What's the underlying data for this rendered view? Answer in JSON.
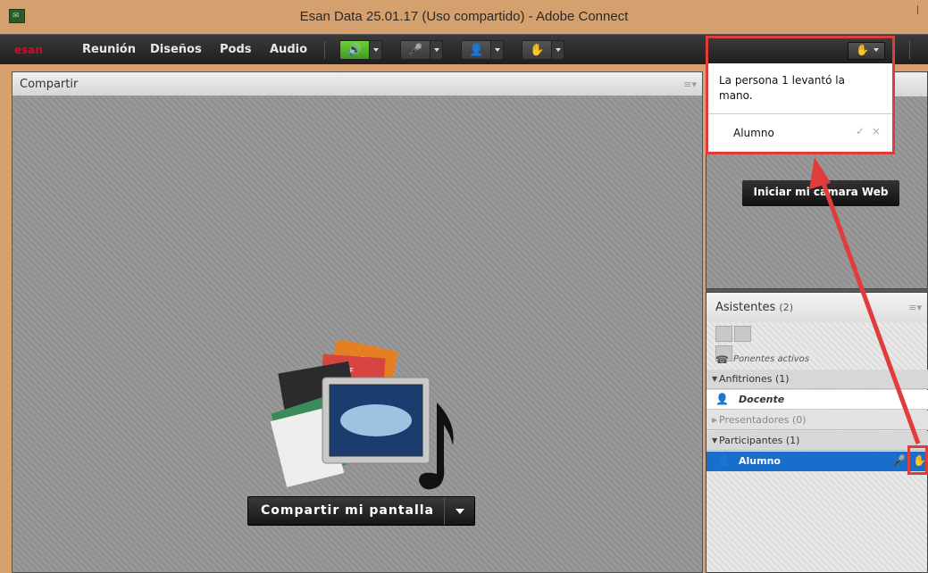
{
  "window": {
    "title": "Esan Data  25.01.17 (Uso compartido) - Adobe Connect"
  },
  "menubar": {
    "logo": "esan",
    "items": [
      "Reunión",
      "Diseños",
      "Pods",
      "Audio"
    ],
    "tools": [
      "speaker-icon",
      "microphone-icon",
      "webcam-icon",
      "raise-hand-icon"
    ]
  },
  "share_pod": {
    "title": "Compartir",
    "share_button": "Compartir mi pantalla",
    "art_labels": {
      "ppt": "PPT",
      "pdf": "PDF"
    }
  },
  "camera_pod": {
    "start_button": "Iniciar mi cámara Web"
  },
  "notification": {
    "message": "La persona 1 levantó la mano.",
    "name": "Alumno",
    "accept": "✓",
    "dismiss": "×"
  },
  "attendees": {
    "title": "Asistentes",
    "count": "(2)",
    "active_speakers": "Ponentes activos",
    "hosts": "Anfitriones (1)",
    "host_name": "Docente",
    "presenters": "Presentadores (0)",
    "participants": "Participantes (1)",
    "participant_name": "Alumno"
  },
  "colors": {
    "highlight": "#e03c3c",
    "selection": "#1a6ecb",
    "audio_active": "#4db82a"
  }
}
